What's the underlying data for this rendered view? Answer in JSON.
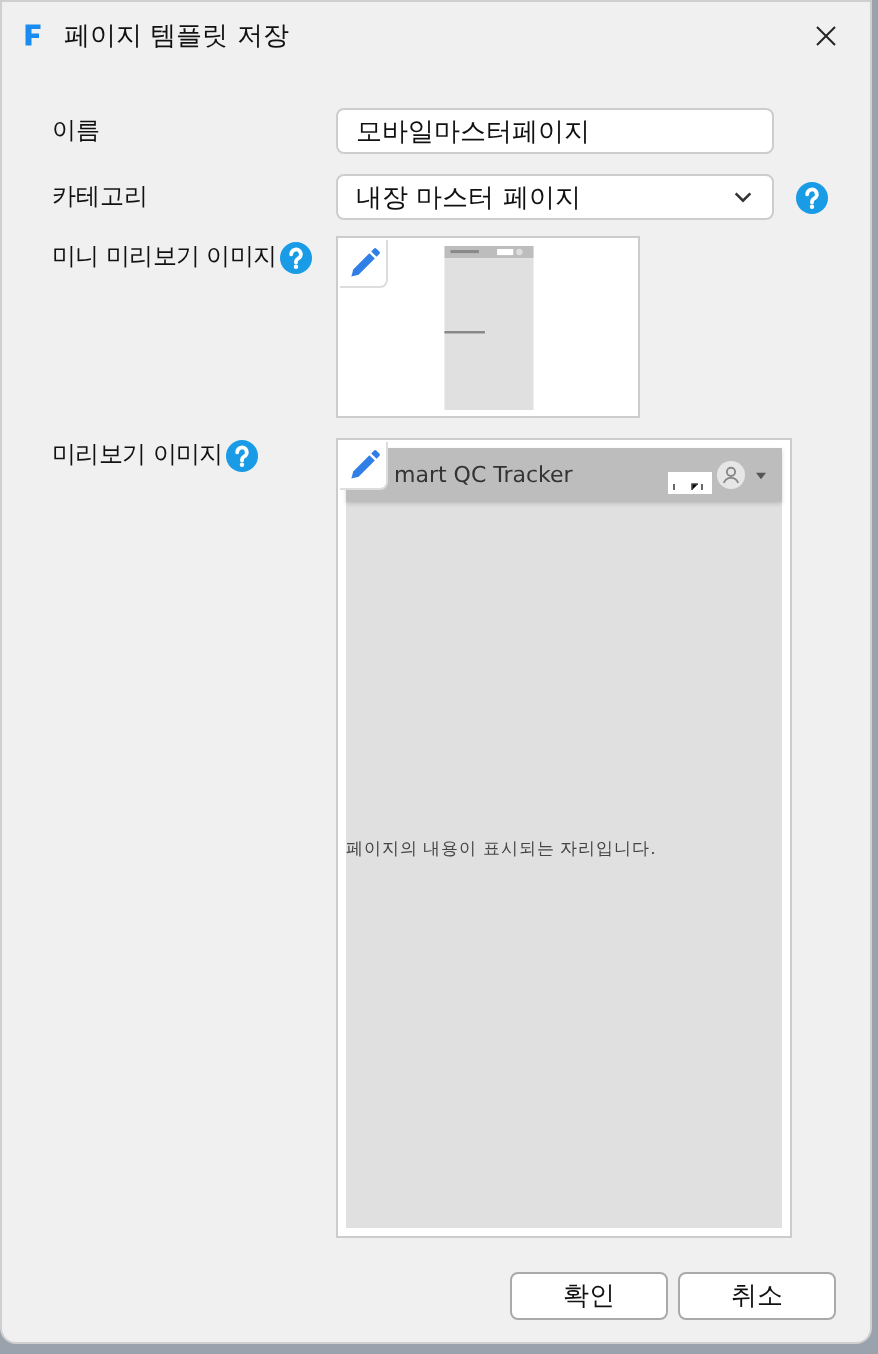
{
  "window": {
    "title": "페이지 템플릿 저장"
  },
  "fields": [
    {
      "kind": "text",
      "label": "이름",
      "value": "모바일마스터페이지",
      "help": false
    },
    {
      "kind": "select",
      "label": "카테고리",
      "value": "내장 마스터 페이지",
      "help": true
    }
  ],
  "mini_preview": {
    "label": "미니 미리보기 이미지"
  },
  "preview": {
    "label": "미리보기 이미지",
    "app_title": "mart QC Tracker",
    "placeholder_text": "페이지의 내용이 표시되는 자리입니다."
  },
  "buttons": [
    "확인",
    "취소"
  ]
}
